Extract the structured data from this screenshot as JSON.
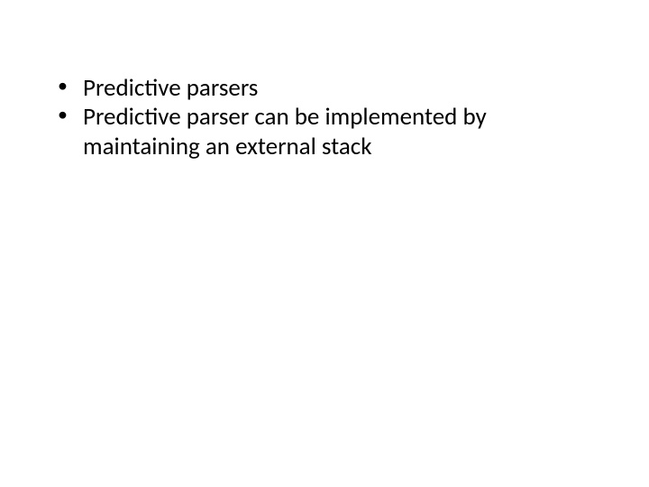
{
  "slide": {
    "bullets": [
      "Predictive parsers",
      "Predictive parser can be implemented by maintaining an external stack"
    ]
  }
}
